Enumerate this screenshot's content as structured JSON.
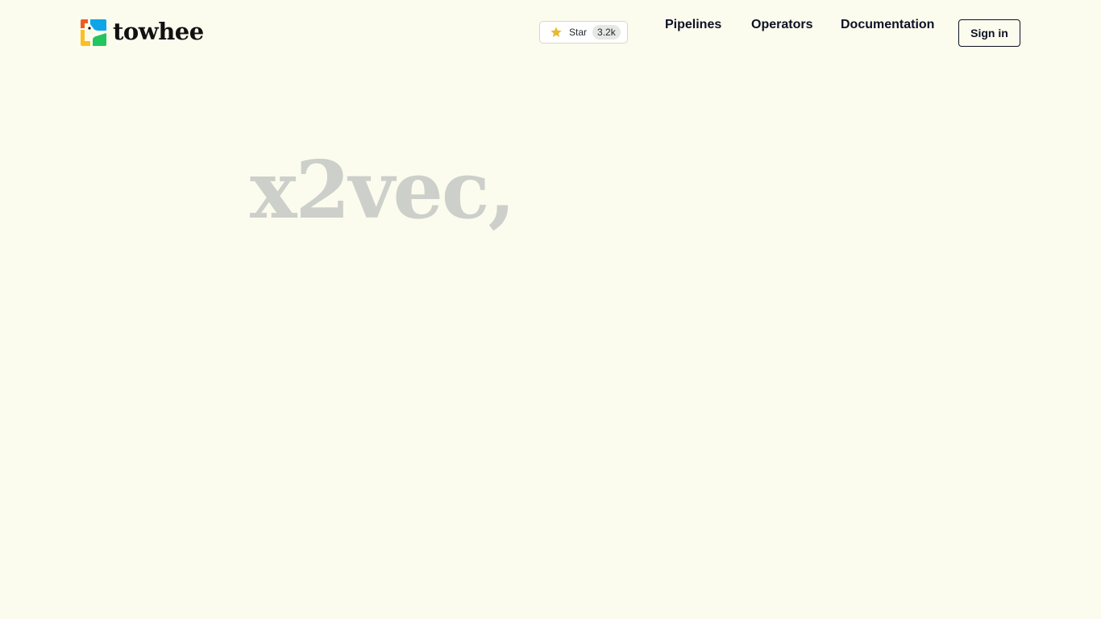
{
  "brand": {
    "name": "towhee",
    "logo_colors": [
      "#f15a22",
      "#fbbf24",
      "#0ea5e9",
      "#22c55e"
    ]
  },
  "github": {
    "star_label": "Star",
    "star_count": "3.2k",
    "star_color": "#e8b931"
  },
  "nav": {
    "items": [
      {
        "label": "Pipelines"
      },
      {
        "label": "Operators"
      },
      {
        "label": "Documentation"
      }
    ],
    "signin_label": "Sign in"
  },
  "hero": {
    "word": "x2vec,",
    "color": "#cccfca"
  },
  "background": "#fbfcee"
}
